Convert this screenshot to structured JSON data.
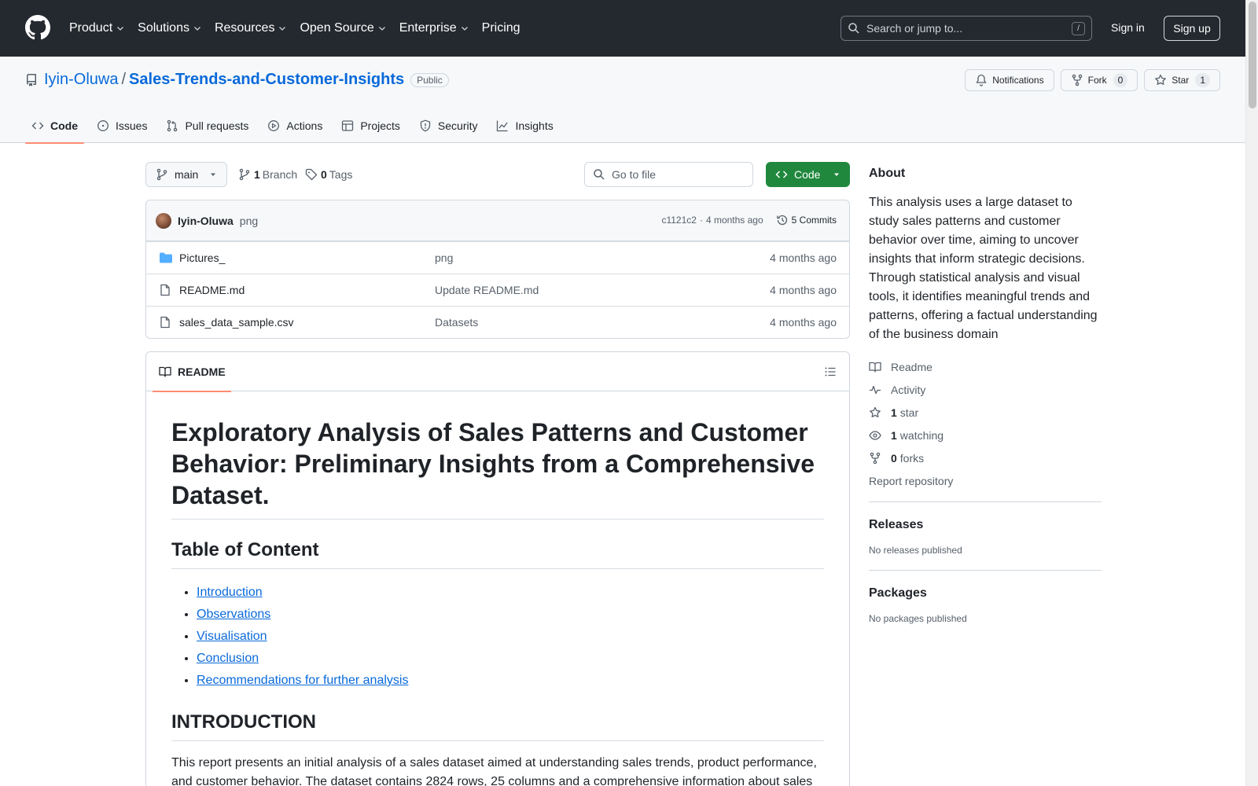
{
  "header": {
    "nav": [
      {
        "label": "Product",
        "has_dropdown": true
      },
      {
        "label": "Solutions",
        "has_dropdown": true
      },
      {
        "label": "Resources",
        "has_dropdown": true
      },
      {
        "label": "Open Source",
        "has_dropdown": true
      },
      {
        "label": "Enterprise",
        "has_dropdown": true
      },
      {
        "label": "Pricing",
        "has_dropdown": false
      }
    ],
    "search_placeholder": "Search or jump to...",
    "search_shortcut": "/",
    "sign_in": "Sign in",
    "sign_up": "Sign up"
  },
  "repo": {
    "owner": "Iyin-Oluwa",
    "separator": "/",
    "name": "Sales-Trends-and-Customer-Insights",
    "visibility": "Public",
    "notifications_label": "Notifications",
    "fork_label": "Fork",
    "fork_count": "0",
    "star_label": "Star",
    "star_count": "1",
    "tabs": [
      {
        "label": "Code",
        "icon": "code-icon",
        "active": true
      },
      {
        "label": "Issues",
        "icon": "issue-icon",
        "active": false
      },
      {
        "label": "Pull requests",
        "icon": "pull-request-icon",
        "active": false
      },
      {
        "label": "Actions",
        "icon": "play-icon",
        "active": false
      },
      {
        "label": "Projects",
        "icon": "table-icon",
        "active": false
      },
      {
        "label": "Security",
        "icon": "shield-icon",
        "active": false
      },
      {
        "label": "Insights",
        "icon": "graph-icon",
        "active": false
      }
    ]
  },
  "toolbar": {
    "branch": "main",
    "branch_count": "1",
    "branch_label": "Branch",
    "tag_count": "0",
    "tag_label": "Tags",
    "goto_placeholder": "Go to file",
    "code_button": "Code"
  },
  "commit": {
    "author": "Iyin-Oluwa",
    "message": "png",
    "hash": "c1121c2",
    "dot": "·",
    "age": "4 months ago",
    "commits_label": "5 Commits"
  },
  "files": [
    {
      "name": "Pictures_",
      "type": "folder",
      "message": "png",
      "age": "4 months ago"
    },
    {
      "name": "README.md",
      "type": "file",
      "message": "Update README.md",
      "age": "4 months ago"
    },
    {
      "name": "sales_data_sample.csv",
      "type": "file",
      "message": "Datasets",
      "age": "4 months ago"
    }
  ],
  "readme": {
    "tab_label": "README",
    "title": "Exploratory Analysis of Sales Patterns and Customer Behavior: Preliminary Insights from a Comprehensive Dataset.",
    "toc_heading": "Table of Content",
    "toc_items": [
      "Introduction",
      "Observations",
      "Visualisation",
      "Conclusion",
      "Recommendations for further analysis"
    ],
    "intro_heading": "INTRODUCTION",
    "intro_text": "This report presents an initial analysis of a sales dataset aimed at understanding sales trends, product performance, and customer behavior. The dataset contains 2824 rows, 25 columns and a comprehensive information about sales"
  },
  "sidebar": {
    "about_heading": "About",
    "about_text": "This analysis uses a large dataset to study sales patterns and customer behavior over time, aiming to uncover insights that inform strategic decisions. Through statistical analysis and visual tools, it identifies meaningful trends and patterns, offering a factual understanding of the business domain",
    "readme_link": "Readme",
    "activity_link": "Activity",
    "stars_count": "1",
    "stars_label": "star",
    "watching_count": "1",
    "watching_label": "watching",
    "forks_count": "0",
    "forks_label": "forks",
    "report_link": "Report repository",
    "releases_heading": "Releases",
    "releases_text": "No releases published",
    "packages_heading": "Packages",
    "packages_text": "No packages published"
  },
  "colors": {
    "header_bg": "#24292f",
    "link": "#0969da",
    "primary_button": "#1f883d",
    "active_tab_underline": "#fd8c73"
  }
}
